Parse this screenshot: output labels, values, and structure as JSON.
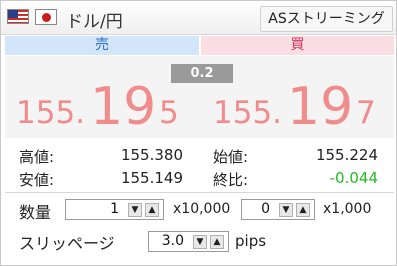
{
  "header": {
    "pair": "ドル/円",
    "streaming_label": "ASストリーミング"
  },
  "sides": {
    "sell": "売",
    "buy": "買"
  },
  "spread": "0.2",
  "bid": {
    "prefix": "155.",
    "big": "19",
    "pip": "5"
  },
  "ask": {
    "prefix": "155.",
    "big": "19",
    "pip": "7"
  },
  "stats": {
    "high_label": "高値:",
    "high_value": "155.380",
    "open_label": "始値:",
    "open_value": "155.224",
    "low_label": "安値:",
    "low_value": "155.149",
    "change_label": "終比:",
    "change_value": "-0.044"
  },
  "quantity": {
    "label": "数量",
    "lots_value": "1",
    "lots_unit": "x10,000",
    "units_value": "0",
    "units_unit": "x1,000"
  },
  "slippage": {
    "label": "スリッページ",
    "value": "3.0",
    "unit": "pips"
  },
  "icons": {
    "up": "▲",
    "down": "▼"
  },
  "colors": {
    "price": "#f08c8c",
    "sell": "#2a6ed0",
    "buy": "#d23a5c",
    "change": "#22bb22"
  }
}
